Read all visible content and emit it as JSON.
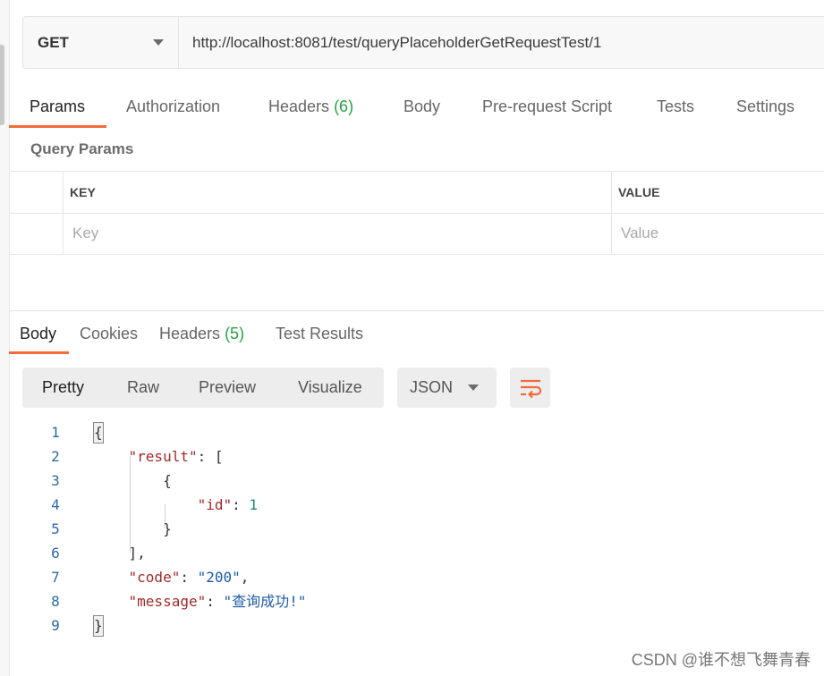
{
  "request": {
    "method": "GET",
    "url": "http://localhost:8081/test/queryPlaceholderGetRequestTest/1"
  },
  "request_tabs": [
    {
      "label": "Params",
      "count": ""
    },
    {
      "label": "Authorization",
      "count": ""
    },
    {
      "label": "Headers",
      "count": "(6)"
    },
    {
      "label": "Body",
      "count": ""
    },
    {
      "label": "Pre-request Script",
      "count": ""
    },
    {
      "label": "Tests",
      "count": ""
    },
    {
      "label": "Settings",
      "count": ""
    }
  ],
  "query_params": {
    "title": "Query Params",
    "key_header": "KEY",
    "value_header": "VALUE",
    "key_placeholder": "Key",
    "value_placeholder": "Value"
  },
  "response_tabs": [
    {
      "label": "Body",
      "count": ""
    },
    {
      "label": "Cookies",
      "count": ""
    },
    {
      "label": "Headers",
      "count": "(5)"
    },
    {
      "label": "Test Results",
      "count": ""
    }
  ],
  "format_options": [
    "Pretty",
    "Raw",
    "Preview",
    "Visualize"
  ],
  "format_selected": "Pretty",
  "language": "JSON",
  "code_lines": [
    {
      "n": "1",
      "parts": [
        {
          "t": "{",
          "c": "p"
        }
      ]
    },
    {
      "n": "2",
      "parts": [
        {
          "t": "    ",
          "c": "p"
        },
        {
          "t": "\"result\"",
          "c": "key"
        },
        {
          "t": ": [",
          "c": "p"
        }
      ]
    },
    {
      "n": "3",
      "parts": [
        {
          "t": "        {",
          "c": "p"
        }
      ]
    },
    {
      "n": "4",
      "parts": [
        {
          "t": "            ",
          "c": "p"
        },
        {
          "t": "\"id\"",
          "c": "key"
        },
        {
          "t": ": ",
          "c": "p"
        },
        {
          "t": "1",
          "c": "num"
        }
      ]
    },
    {
      "n": "5",
      "parts": [
        {
          "t": "        }",
          "c": "p"
        }
      ]
    },
    {
      "n": "6",
      "parts": [
        {
          "t": "    ],",
          "c": "p"
        }
      ]
    },
    {
      "n": "7",
      "parts": [
        {
          "t": "    ",
          "c": "p"
        },
        {
          "t": "\"code\"",
          "c": "key"
        },
        {
          "t": ": ",
          "c": "p"
        },
        {
          "t": "\"200\"",
          "c": "str"
        },
        {
          "t": ",",
          "c": "p"
        }
      ]
    },
    {
      "n": "8",
      "parts": [
        {
          "t": "    ",
          "c": "p"
        },
        {
          "t": "\"message\"",
          "c": "key"
        },
        {
          "t": ": ",
          "c": "p"
        },
        {
          "t": "\"查询成功!\"",
          "c": "str"
        }
      ]
    },
    {
      "n": "9",
      "parts": [
        {
          "t": "}",
          "c": "p"
        }
      ]
    }
  ],
  "watermark": "CSDN @谁不想飞舞青春",
  "colors": {
    "accent": "#f26b3a",
    "count": "#26a248",
    "json_key": "#a22a2a",
    "json_string": "#1f5aa8",
    "json_number": "#1b8a6b"
  }
}
